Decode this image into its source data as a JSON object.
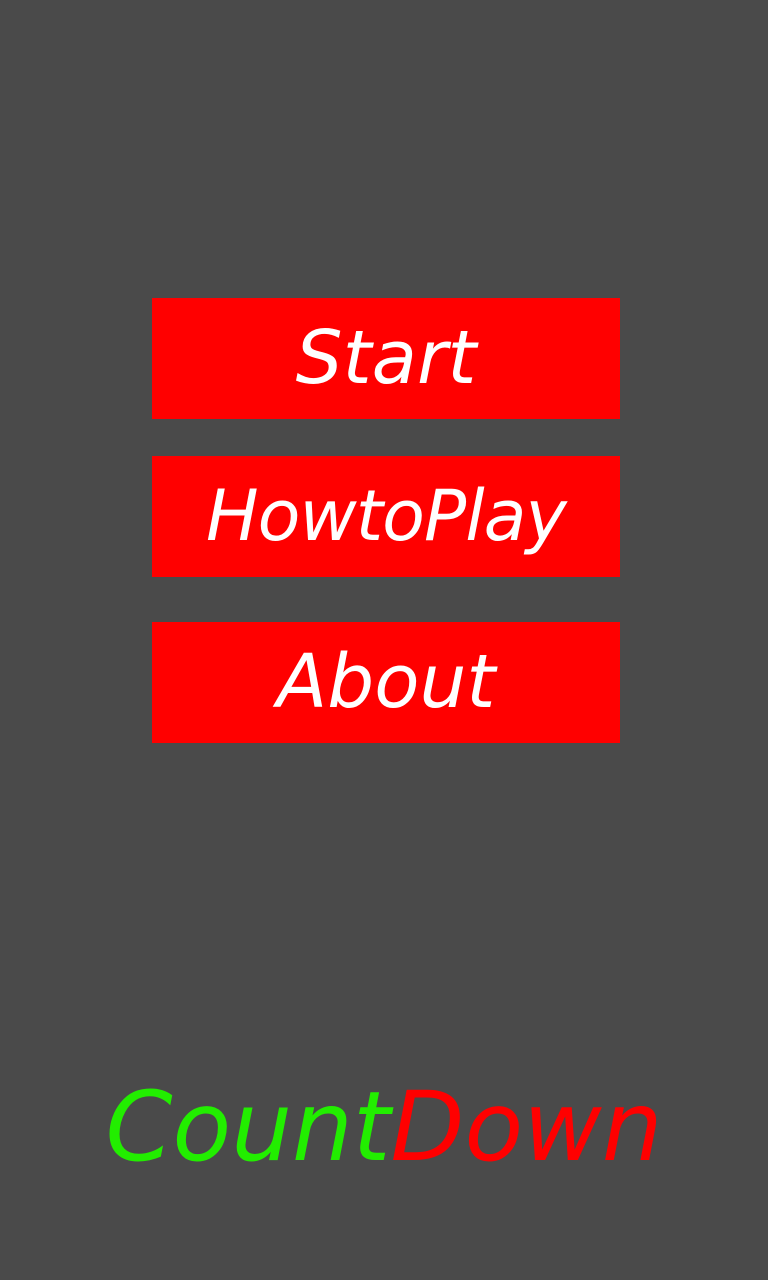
{
  "menu": {
    "start_label": "Start",
    "how_to_play_label": "HowtoPlay",
    "about_label": "About"
  },
  "logo": {
    "part_count": "Count",
    "part_down": "Down"
  },
  "colors": {
    "background": "#4a4a4a",
    "button_fill": "#ff0000",
    "button_text": "#ffffff",
    "logo_count": "#22ee00",
    "logo_down": "#ff0000"
  }
}
